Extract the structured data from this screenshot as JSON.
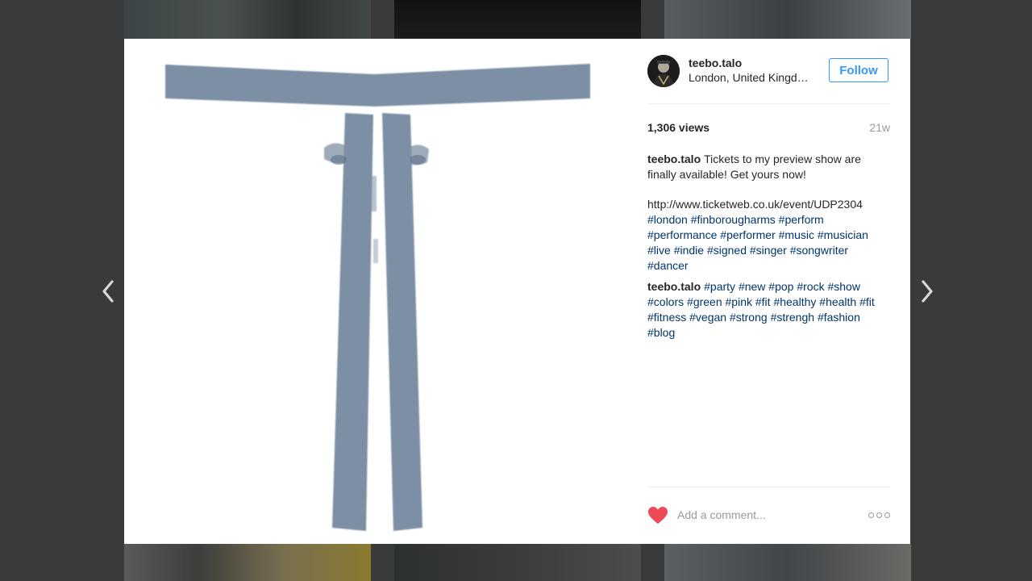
{
  "colors": {
    "overlay": "#3a3a3a",
    "follow_blue": "#3897f0",
    "hashtag": "#003569",
    "heart_red": "#ed4956",
    "muted": "#999999",
    "figure_blue": "#7c8fa4"
  },
  "navigation": {
    "prev_icon": "chevron-left-icon",
    "next_icon": "chevron-right-icon"
  },
  "post": {
    "user": {
      "username": "teebo.talo",
      "location": "London, United Kingdom"
    },
    "follow_label": "Follow",
    "views": "1,306 views",
    "age": "21w",
    "caption": {
      "author": "teebo.talo",
      "lines": [
        "Tickets to my preview show are finally available! Get yours now!"
      ],
      "url": "http://www.ticketweb.co.uk/event/UDP2304",
      "hashtags": [
        "#london",
        "#finborougharms",
        "#perform",
        "#performance",
        "#performer",
        "#music",
        "#musician",
        "#live",
        "#indie",
        "#signed",
        "#singer",
        "#songwriter",
        "#dancer"
      ]
    },
    "comment": {
      "author": "teebo.talo",
      "hashtags": [
        "#party",
        "#new",
        "#pop",
        "#rock",
        "#show",
        "#colors",
        "#green",
        "#pink",
        "#fit",
        "#healthy",
        "#health",
        "#fit",
        "#fitness",
        "#vegan",
        "#strong",
        "#strengh",
        "#fashion",
        "#blog"
      ]
    },
    "comment_placeholder": "Add a comment...",
    "icons": {
      "like": "heart-icon",
      "more": "more-options-icon"
    }
  }
}
